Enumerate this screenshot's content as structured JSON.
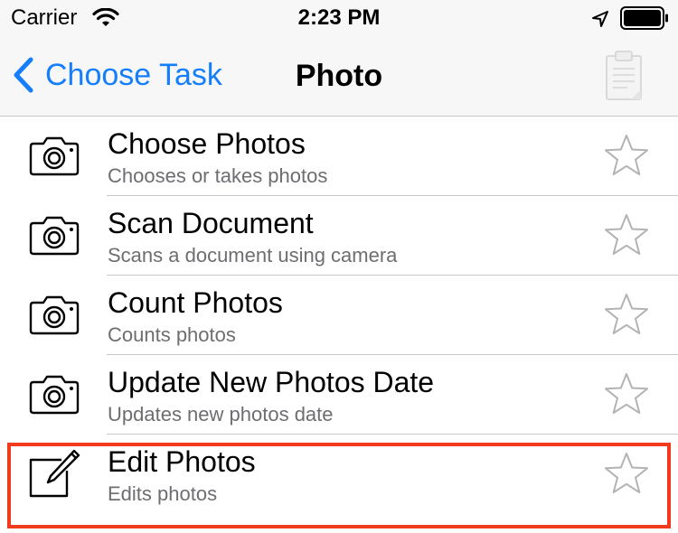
{
  "status_bar": {
    "carrier": "Carrier",
    "time": "2:23 PM",
    "icons": [
      "wifi-icon",
      "location-arrow-icon",
      "battery-icon"
    ]
  },
  "nav": {
    "back_label": "Choose Task",
    "title": "Photo",
    "right_icon": "clipboard-icon",
    "accent_color": "#157efb"
  },
  "tasks": [
    {
      "title": "Choose Photos",
      "subtitle": "Chooses or takes photos",
      "icon": "camera-icon"
    },
    {
      "title": "Scan Document",
      "subtitle": "Scans a document using camera",
      "icon": "camera-icon"
    },
    {
      "title": "Count Photos",
      "subtitle": "Counts photos",
      "icon": "camera-icon"
    },
    {
      "title": "Update New Photos Date",
      "subtitle": "Updates new photos date",
      "icon": "camera-icon"
    },
    {
      "title": "Edit Photos",
      "subtitle": "Edits photos",
      "icon": "pencil-icon",
      "highlighted": true
    }
  ],
  "colors": {
    "highlight": "#f23a1c",
    "separator": "#c8c7cc",
    "subtitle": "#6d6d72"
  }
}
